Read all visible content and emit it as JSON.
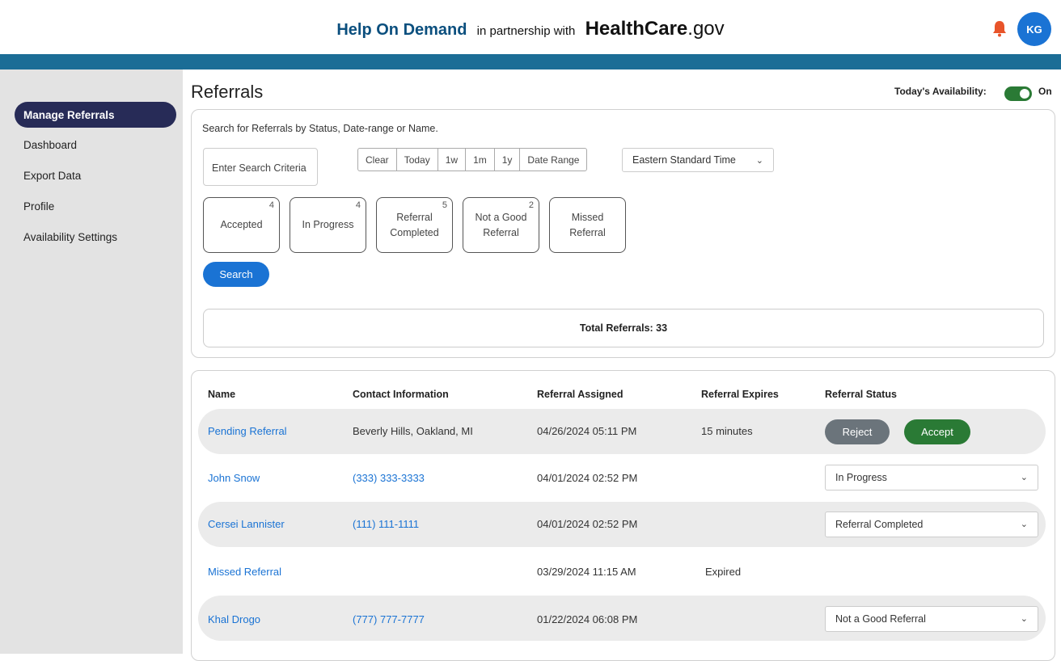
{
  "header": {
    "brand": "Help On Demand",
    "partner_text": "in partnership with",
    "partner_brand": "HealthCare",
    "partner_suffix": ".gov",
    "avatar_initials": "KG"
  },
  "colors": {
    "nav_active": "#272b57",
    "blue_bar": "#1b6d96",
    "link": "#1a73d4",
    "accept": "#2a7a35",
    "reject": "#6b747b",
    "bell": "#e8542a"
  },
  "sidebar": {
    "items": [
      {
        "label": "Manage Referrals",
        "active": true
      },
      {
        "label": "Dashboard"
      },
      {
        "label": "Export Data"
      },
      {
        "label": "Profile"
      },
      {
        "label": "Availability Settings"
      }
    ]
  },
  "page": {
    "title": "Referrals",
    "availability_label": "Today's Availability:",
    "availability_state": "On"
  },
  "search": {
    "hint": "Search for Referrals by Status, Date-range or Name.",
    "placeholder": "Enter Search Criteria",
    "ranges": [
      "Clear",
      "Today",
      "1w",
      "1m",
      "1y",
      "Date Range"
    ],
    "timezone": "Eastern Standard Time",
    "statuses": [
      {
        "label": "Accepted",
        "count": "4"
      },
      {
        "label": "In Progress",
        "count": "4"
      },
      {
        "label": "Referral Completed",
        "count": "5"
      },
      {
        "label": "Not a Good Referral",
        "count": "2"
      },
      {
        "label": "Missed Referral",
        "count": ""
      }
    ],
    "search_button": "Search",
    "total": "Total Referrals: 33"
  },
  "table": {
    "headers": [
      "Name",
      "Contact Information",
      "Referral Assigned",
      "Referral Expires",
      "Referral Status"
    ],
    "rows": [
      {
        "name": "Pending Referral",
        "contact": "Beverly Hills, Oakland, MI",
        "assigned": "04/26/2024 05:11 PM",
        "expires": "15 minutes",
        "reject": "Reject",
        "accept": "Accept"
      },
      {
        "name": "John Snow",
        "contact": "(333) 333-3333",
        "assigned": "04/01/2024 02:52 PM",
        "expires": "",
        "status": "In Progress"
      },
      {
        "name": "Cersei Lannister",
        "contact": "(111) 111-1111",
        "assigned": "04/01/2024 02:52 PM",
        "expires": "",
        "status": "Referral Completed"
      },
      {
        "name": "Missed Referral",
        "contact": "",
        "assigned": "03/29/2024 11:15 AM",
        "expires": "Expired"
      },
      {
        "name": "Khal Drogo",
        "contact": "(777) 777-7777",
        "assigned": "01/22/2024 06:08 PM",
        "expires": "",
        "status": "Not a Good Referral"
      }
    ]
  }
}
